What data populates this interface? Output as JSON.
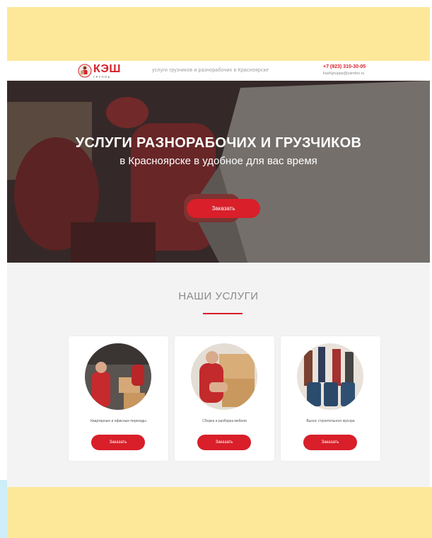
{
  "header": {
    "logo_text": "КЭШ",
    "logo_subtext": "ГРУППА",
    "tagline": "услуги грузчиков и разнорабочих в Красноярске",
    "phone": "+7 (923) 310-30-05",
    "email": "kashgruppa@yandex.ru"
  },
  "hero": {
    "title": "УСЛУГИ РАЗНОРАБОЧИХ И ГРУЗЧИКОВ",
    "subtitle": "в Красноярске в удобное для вас время",
    "button_label": "Заказать"
  },
  "services": {
    "title": "НАШИ УСЛУГИ",
    "items": [
      {
        "label": "Квартирные и офисные переезды",
        "button_label": "Заказать"
      },
      {
        "label": "Сборка и разборка мебели",
        "button_label": "Заказать"
      },
      {
        "label": "Вынос строительного мусора",
        "button_label": "Заказать"
      }
    ]
  },
  "colors": {
    "accent": "#d81f2a",
    "band": "#fde89a",
    "band_side": "#cdeef8",
    "page_bg": "#f3f3f3"
  }
}
